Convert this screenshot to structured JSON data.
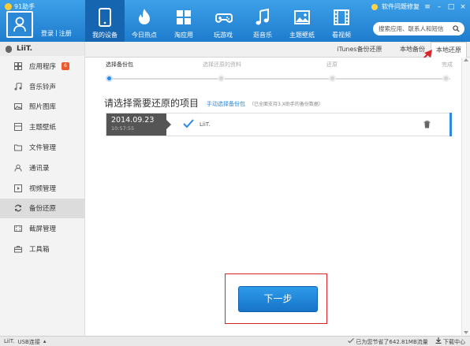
{
  "window": {
    "title": "91助手"
  },
  "header": {
    "login": "登录",
    "separator": "|",
    "register": "注册",
    "nav": [
      {
        "label": "我的设备",
        "icon": "phone-icon",
        "active": true
      },
      {
        "label": "今日热点",
        "icon": "flame-icon"
      },
      {
        "label": "淘应用",
        "icon": "apps-grid-icon"
      },
      {
        "label": "玩游戏",
        "icon": "gamepad-icon"
      },
      {
        "label": "逛音乐",
        "icon": "music-note-icon"
      },
      {
        "label": "主题壁纸",
        "icon": "image-icon"
      },
      {
        "label": "看视频",
        "icon": "film-icon"
      }
    ],
    "feedback": "软件问题修复",
    "search_placeholder": "搜索应用、联系人和短信"
  },
  "sidebar": {
    "device_name": "LiiT.",
    "items": [
      {
        "label": "应用程序",
        "icon": "apps-icon",
        "badge": "6"
      },
      {
        "label": "音乐铃声",
        "icon": "music-icon"
      },
      {
        "label": "照片图库",
        "icon": "photo-icon"
      },
      {
        "label": "主题壁纸",
        "icon": "wallpaper-icon"
      },
      {
        "label": "文件管理",
        "icon": "folder-icon"
      },
      {
        "label": "通讯录",
        "icon": "contacts-icon"
      },
      {
        "label": "视频管理",
        "icon": "video-icon"
      },
      {
        "label": "备份还原",
        "icon": "backup-restore-icon",
        "active": true
      },
      {
        "label": "截屏管理",
        "icon": "screenshot-icon"
      },
      {
        "label": "工具箱",
        "icon": "toolbox-icon"
      }
    ]
  },
  "tabs": [
    {
      "label": "iTunes备份还原"
    },
    {
      "label": "本地备份"
    },
    {
      "label": "本地还原",
      "active": true
    }
  ],
  "steps": [
    {
      "label": "选择备份包",
      "active": true
    },
    {
      "label": "选择还原的资料"
    },
    {
      "label": "还原"
    },
    {
      "label": "完成"
    }
  ],
  "main": {
    "heading": "请选择需要还原的项目",
    "manual_link": "手动选择备份包",
    "note": "（已全面支持3.X助手的备份数据）",
    "backup": {
      "date": "2014.09.23",
      "time": "10:57:55",
      "device": "LiiT."
    },
    "next_button": "下一步"
  },
  "status": {
    "device": "LiiT.",
    "connection": "USB连接",
    "saved": "已为您节省了642.81MB流量",
    "download_center": "下载中心"
  },
  "colors": {
    "accent": "#2d8ae0",
    "header": "#1e7ccd",
    "highlight_red": "#d9242a"
  }
}
